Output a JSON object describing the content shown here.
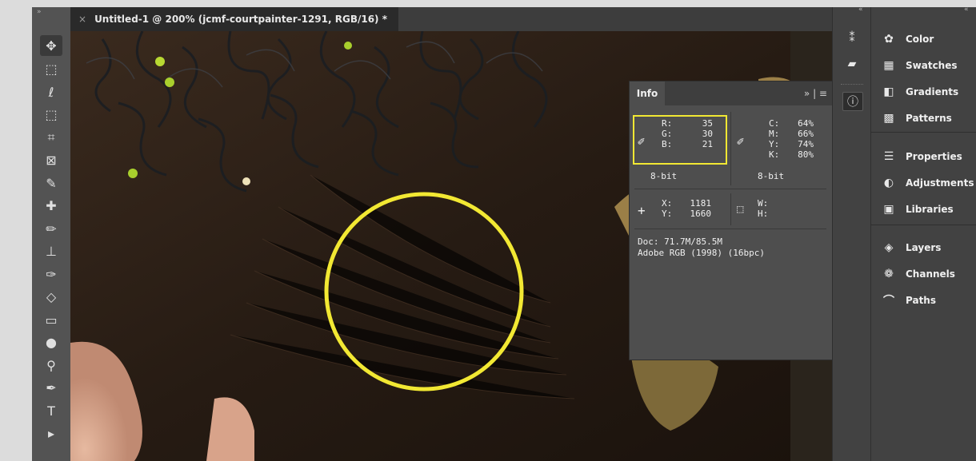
{
  "window": {
    "tab_close": "×",
    "document_title": "Untitled-1 @ 200% (jcmf-courtpainter-1291, RGB/16) *",
    "expand_left": "»",
    "collapse_icons": "«",
    "collapse_panel": "«"
  },
  "toolbar": {
    "tools": [
      {
        "name": "move-tool-icon",
        "glyph": "✥"
      },
      {
        "name": "marquee-tool-icon",
        "glyph": "⬚"
      },
      {
        "name": "lasso-tool-icon",
        "glyph": "ℓ"
      },
      {
        "name": "object-select-tool-icon",
        "glyph": "⬚"
      },
      {
        "name": "crop-tool-icon",
        "glyph": "⌗"
      },
      {
        "name": "frame-tool-icon",
        "glyph": "⊠"
      },
      {
        "name": "eyedropper-tool-icon",
        "glyph": "✎"
      },
      {
        "name": "healing-brush-tool-icon",
        "glyph": "✚"
      },
      {
        "name": "brush-tool-icon",
        "glyph": "✏"
      },
      {
        "name": "clone-stamp-tool-icon",
        "glyph": "⊥"
      },
      {
        "name": "history-brush-tool-icon",
        "glyph": "✑"
      },
      {
        "name": "eraser-tool-icon",
        "glyph": "◇"
      },
      {
        "name": "gradient-tool-icon",
        "glyph": "▭"
      },
      {
        "name": "blur-tool-icon",
        "glyph": "●"
      },
      {
        "name": "dodge-tool-icon",
        "glyph": "⚲"
      },
      {
        "name": "pen-tool-icon",
        "glyph": "✒"
      },
      {
        "name": "type-tool-icon",
        "glyph": "T"
      },
      {
        "name": "path-select-tool-icon",
        "glyph": "▸"
      }
    ]
  },
  "info_panel": {
    "tab_label": "Info",
    "menu_glyph": "»  |  ≡",
    "rgb": {
      "r_label": "R:",
      "g_label": "G:",
      "b_label": "B:",
      "r": "35",
      "g": "30",
      "b": "21",
      "bit": "8-bit"
    },
    "cmyk": {
      "c_label": "C:",
      "m_label": "M:",
      "y_label": "Y:",
      "k_label": "K:",
      "c": "64%",
      "m": "66%",
      "y": "74%",
      "k": "80%",
      "bit": "8-bit"
    },
    "position": {
      "x_label": "X:",
      "y_label": "Y:",
      "x": "1181",
      "y": "1660"
    },
    "size": {
      "w_label": "W:",
      "h_label": "H:",
      "w": "",
      "h": ""
    },
    "doc": "Doc: 71.7M/85.5M",
    "profile": "Adobe RGB (1998) (16bpc)"
  },
  "right_panel": {
    "items": [
      {
        "label": "Color",
        "icon": "color-icon",
        "glyph": "✿"
      },
      {
        "label": "Swatches",
        "icon": "swatches-icon",
        "glyph": "▦"
      },
      {
        "label": "Gradients",
        "icon": "gradients-icon",
        "glyph": "◧"
      },
      {
        "label": "Patterns",
        "icon": "patterns-icon",
        "glyph": "▩"
      },
      {
        "label": "Properties",
        "icon": "properties-icon",
        "glyph": "☰"
      },
      {
        "label": "Adjustments",
        "icon": "adjustments-icon",
        "glyph": "◐"
      },
      {
        "label": "Libraries",
        "icon": "libraries-icon",
        "glyph": "▣"
      },
      {
        "label": "Layers",
        "icon": "layers-icon",
        "glyph": "◈"
      },
      {
        "label": "Channels",
        "icon": "channels-icon",
        "glyph": "❁"
      },
      {
        "label": "Paths",
        "icon": "paths-icon",
        "glyph": "⌒"
      }
    ]
  },
  "colors": {
    "highlight_ring": "#f2e833",
    "panel_bg": "#424242",
    "canvas_bg": "#2a1f17"
  }
}
